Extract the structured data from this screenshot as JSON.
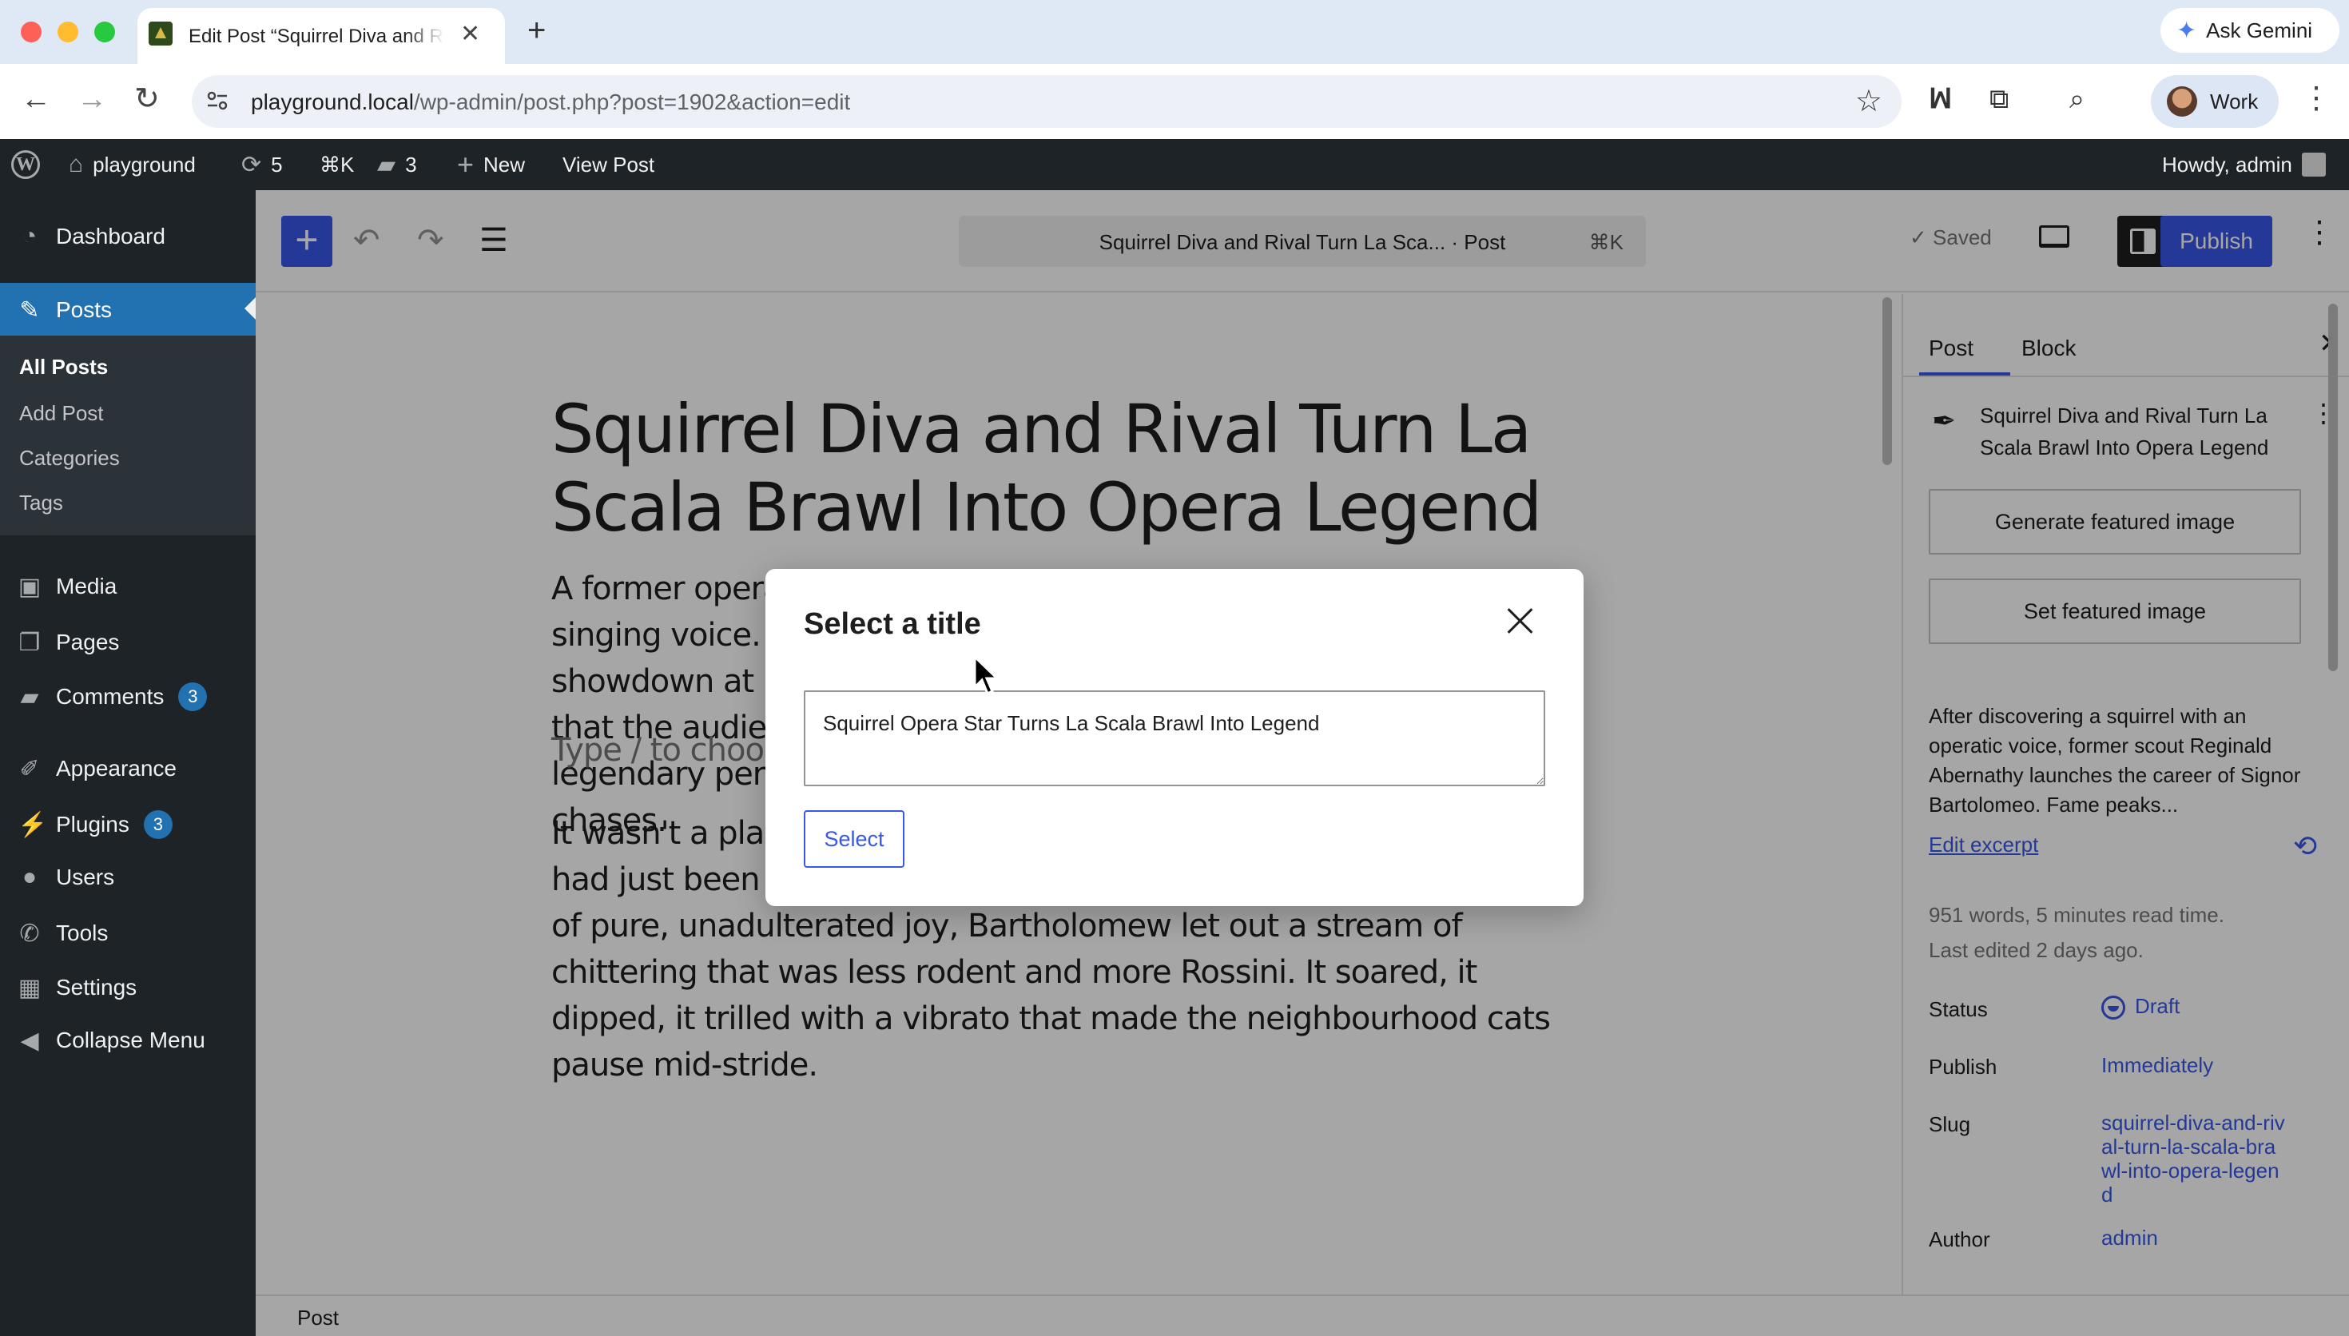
{
  "browser": {
    "tab_title": "Edit Post “Squirrel Diva and Rival Turn La Scala Brawl Into Opera Legend” ‹ playground — WordPress",
    "gemini_label": "Ask Gemini",
    "url_host": "playground.local",
    "url_path": "/wp-admin/post.php?post=1902&action=edit",
    "profile_label": "Work"
  },
  "adminbar": {
    "site": "playground",
    "updates": "5",
    "shortcut": "⌘K",
    "comments": "3",
    "new_label": "New",
    "view_post": "View Post",
    "howdy": "Howdy, admin"
  },
  "sidebar": {
    "dashboard": "Dashboard",
    "posts": "Posts",
    "sub": [
      "All Posts",
      "Add Post",
      "Categories",
      "Tags"
    ],
    "media": "Media",
    "pages": "Pages",
    "comments": "Comments",
    "comments_count": "3",
    "appearance": "Appearance",
    "plugins": "Plugins",
    "plugins_count": "3",
    "users": "Users",
    "tools": "Tools",
    "settings": "Settings",
    "collapse": "Collapse Menu"
  },
  "editor": {
    "command_title": "Squirrel Diva and Rival Turn La Sca... · Post",
    "command_shortcut": "⌘K",
    "saved_label": "Saved",
    "publish_label": "Publish",
    "post_title": "Squirrel Diva and Rival Turn La Scala Brawl Into Opera Legend",
    "paragraph1": "A former opera scout discovers a squirrel with a magnificent singing voice. Fame brings diva demands and rivalries, peaking in a showdown at La Scala where a rival squirrel sparks a chaotic brawl that the audience mistakes for an accidental stage spectacle — a legendary performance pairing that blends singing with high-speed chases.",
    "placeholder": "Type / to choose a block",
    "paragraph2": "It wasn't a planned debut. A particularly plump and perfect almond had just been pilfered from a nearby bird feeder, and in a moment of pure, unadulterated joy, Bartholomew let out a stream of chittering that was less rodent and more Rossini. It soared, it dipped, it trilled with a vibrato that made the neighbourhood cats pause mid-stride.",
    "footer": "Post"
  },
  "panel": {
    "tab_post": "Post",
    "tab_block": "Block",
    "title": "Squirrel Diva and Rival Turn La Scala Brawl Into Opera Legend",
    "generate_image": "Generate featured image",
    "set_image": "Set featured image",
    "excerpt": "After discovering a squirrel with an operatic voice, former scout Reginald Abernathy launches the career of Signor Bartolomeo. Fame peaks...",
    "edit_excerpt": "Edit excerpt",
    "word_count": "951 words, 5 minutes read time.",
    "last_edited": "Last edited 2 days ago.",
    "status_label": "Status",
    "status_value": "Draft",
    "publish_label": "Publish",
    "publish_value": "Immediately",
    "slug_label": "Slug",
    "slug_value": "squirrel-diva-and-rival-turn-la-scala-brawl-into-opera-legend",
    "author_label": "Author",
    "author_value": "admin"
  },
  "modal": {
    "title": "Select a title",
    "input_value": "Squirrel Opera Star Turns La Scala Brawl Into Legend",
    "select_label": "Select"
  },
  "colors": {
    "wp_blue": "#3858e9",
    "admin_dark": "#1d2327",
    "menu_active": "#2271b1"
  }
}
